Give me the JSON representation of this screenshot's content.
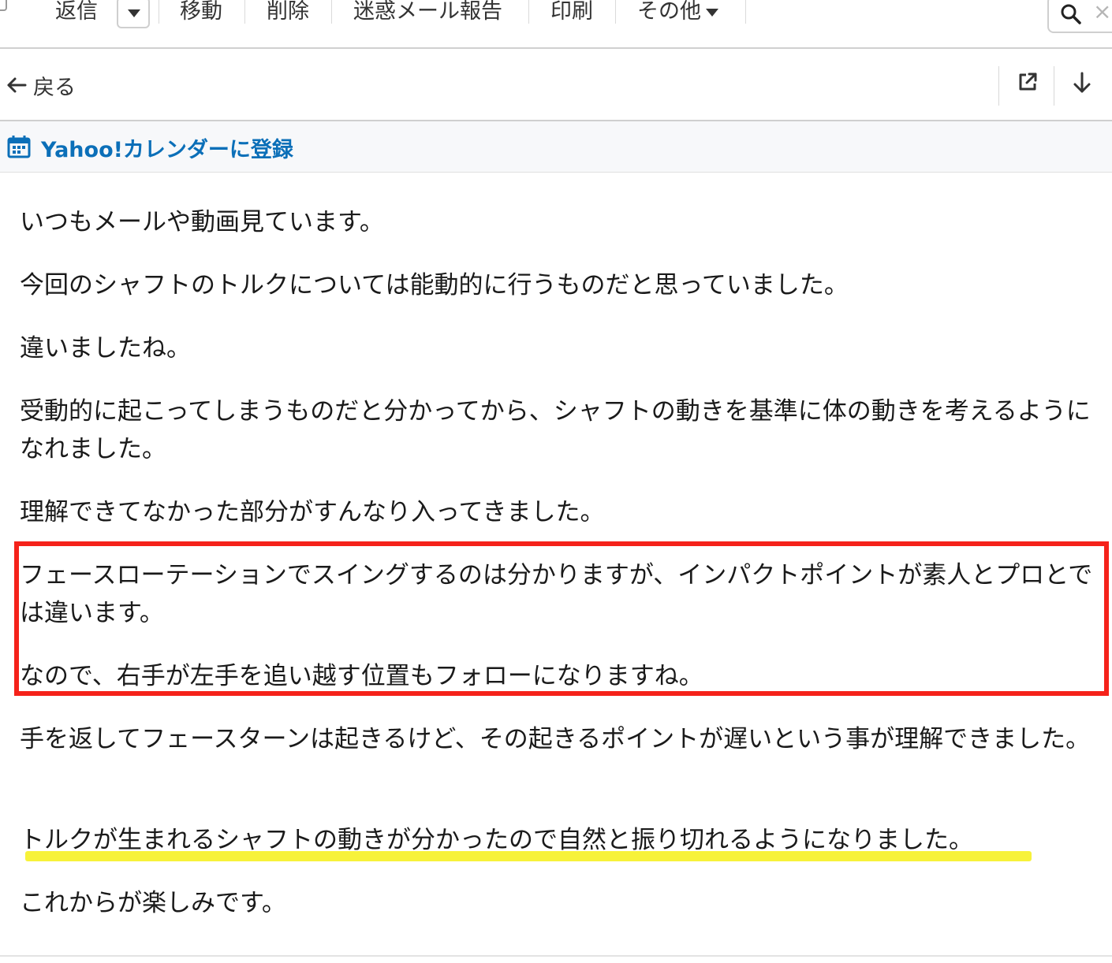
{
  "toolbar": {
    "reply": "返信",
    "move": "移動",
    "delete": "削除",
    "spam": "迷惑メール報告",
    "print": "印刷",
    "more": "その他"
  },
  "nav": {
    "back": "戻る"
  },
  "calendar": {
    "link": "Yahoo!カレンダーに登録",
    "color": "#0b6fb8"
  },
  "message": {
    "paragraphs": [
      "いつもメールや動画見ています。",
      "今回のシャフトのトルクについては能動的に行うものだと思っていました。",
      "違いましたね。",
      "受動的に起こってしまうものだと分かってから、シャフトの動きを基準に体の動きを考えるようになれました。",
      "理解できてなかった部分がすんなり入ってきました。",
      "フェースローテーションでスイングするのは分かりますが、インパクトポイントが素人とプロとでは違います。",
      "なので、右手が左手を追い越す位置もフォローになりますね。",
      "手を返してフェースターンは起きるけど、その起きるポイントが遅いという事が理解できました。",
      "トルクが生まれるシャフトの動きが分かったので自然と振り切れるようになりました。",
      "これからが楽しみです。"
    ]
  },
  "annotations": {
    "box_color": "#f5221a",
    "underline_color": "#f7f23a"
  }
}
